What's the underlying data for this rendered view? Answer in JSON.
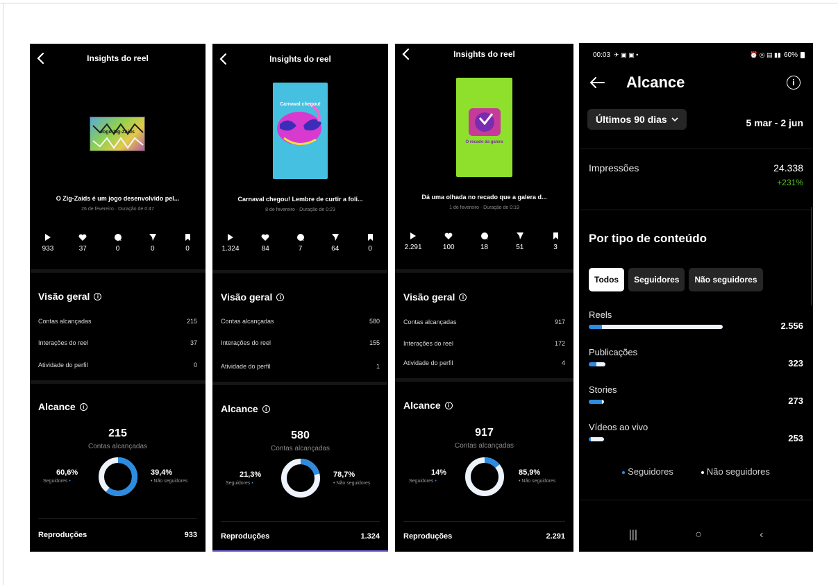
{
  "reel_screens": [
    {
      "header_title": "Insights do reel",
      "caption": "O Zig-Zaids é um jogo desenvolvido pel...",
      "subcaption": "26 de fevereiro · Duração de 0:47",
      "stats": {
        "plays": "933",
        "likes": "37",
        "comments": "0",
        "shares": "0",
        "saves": "0"
      },
      "overview_title": "Visão geral",
      "overview_rows": [
        {
          "label": "Contas alcançadas",
          "value": "215"
        },
        {
          "label": "Interações do reel",
          "value": "37"
        },
        {
          "label": "Atividade do perfil",
          "value": "0"
        }
      ],
      "reach_title": "Alcance",
      "reach_number": "215",
      "reach_label": "Contas alcançadas",
      "followers_pct": "60,6%",
      "followers_label": "Seguidores",
      "nonfollowers_pct": "39,4%",
      "nonfollowers_label": "Não seguidores",
      "followers_fraction": 0.606,
      "footer_label": "Reproduções",
      "footer_value": "933"
    },
    {
      "header_title": "Insights do reel",
      "caption": "Carnaval chegou! Lembre de curtir a foli...",
      "subcaption": "8 de fevereiro · Duração de 0:23",
      "stats": {
        "plays": "1.324",
        "likes": "84",
        "comments": "7",
        "shares": "64",
        "saves": "0"
      },
      "overview_title": "Visão geral",
      "overview_rows": [
        {
          "label": "Contas alcançadas",
          "value": "580"
        },
        {
          "label": "Interações do reel",
          "value": "155"
        },
        {
          "label": "Atividade do perfil",
          "value": "1"
        }
      ],
      "reach_title": "Alcance",
      "reach_number": "580",
      "reach_label": "Contas alcançadas",
      "followers_pct": "21,3%",
      "followers_label": "Seguidores",
      "nonfollowers_pct": "78,7%",
      "nonfollowers_label": "Não seguidores",
      "followers_fraction": 0.213,
      "footer_label": "Reproduções",
      "footer_value": "1.324"
    },
    {
      "header_title": "Insights do reel",
      "caption": "Dá uma olhada no recado que a galera d...",
      "subcaption": "1 de fevereiro · Duração de 0:19",
      "stats": {
        "plays": "2.291",
        "likes": "100",
        "comments": "18",
        "shares": "51",
        "saves": "3"
      },
      "overview_title": "Visão geral",
      "overview_rows": [
        {
          "label": "Contas alcançadas",
          "value": "917"
        },
        {
          "label": "Interações do reel",
          "value": "172"
        },
        {
          "label": "Atividade do perfil",
          "value": "4"
        }
      ],
      "reach_title": "Alcance",
      "reach_number": "917",
      "reach_label": "Contas alcançadas",
      "followers_pct": "14%",
      "followers_label": "Seguidores",
      "nonfollowers_pct": "85,9%",
      "nonfollowers_label": "Não seguidores",
      "followers_fraction": 0.14,
      "footer_label": "Reproduções",
      "footer_value": "2.291"
    }
  ],
  "thumb_texts": {
    "zigzaids": "Jogo Zig-Zaids",
    "carnaval": "Carnaval chegou!",
    "recado": "O recado da galera"
  },
  "alcance": {
    "status_time": "00:03",
    "status_battery": "60%",
    "title": "Alcance",
    "period_label": "Últimos 90 dias",
    "date_range": "5 mar - 2 jun",
    "impressions_label": "Impressões",
    "impressions_value": "24.338",
    "impressions_delta": "+231%",
    "content_type_title": "Por tipo de conteúdo",
    "tabs": [
      "Todos",
      "Seguidores",
      "Não seguidores"
    ],
    "content_rows": [
      {
        "label": "Reels",
        "value": "2.556",
        "share": 1.0,
        "followers_fraction": 0.1
      },
      {
        "label": "Publicações",
        "value": "323",
        "share": 0.126,
        "followers_fraction": 0.45
      },
      {
        "label": "Stories",
        "value": "273",
        "share": 0.107,
        "followers_fraction": 0.85
      },
      {
        "label": "Vídeos ao vivo",
        "value": "253",
        "share": 0.099,
        "followers_fraction": 0.15
      }
    ],
    "legend_followers": "Seguidores",
    "legend_nonfollowers": "Não seguidores"
  },
  "colors": {
    "accent_blue": "#2d8be0",
    "light_ring": "#eef3fb",
    "positive_green": "#58c322"
  }
}
